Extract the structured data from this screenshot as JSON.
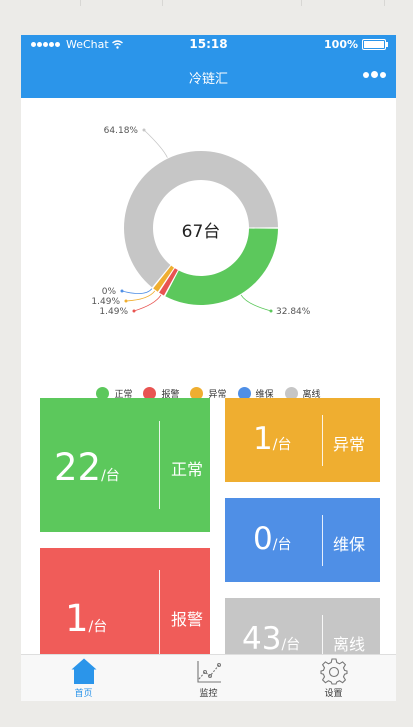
{
  "status_bar": {
    "carrier": "WeChat",
    "time": "15:18",
    "battery": "100%"
  },
  "nav": {
    "title": "冷链汇"
  },
  "chart_data": {
    "type": "pie",
    "variant": "donut",
    "center_label": "67台",
    "total": 67,
    "slices": [
      {
        "name": "正常",
        "value": 22,
        "percent": "32.84%",
        "color": "#5cc85c"
      },
      {
        "name": "报警",
        "value": 1,
        "percent": "1.49%",
        "color": "#e85451"
      },
      {
        "name": "异常",
        "value": 1,
        "percent": "1.49%",
        "color": "#efae30"
      },
      {
        "name": "维保",
        "value": 0,
        "percent": "0%",
        "color": "#4f8fe6"
      },
      {
        "name": "离线",
        "value": 43,
        "percent": "64.18%",
        "color": "#c6c6c6"
      }
    ],
    "legend_placement": "bottom"
  },
  "tiles": {
    "unit": "/台",
    "normal": {
      "value": "22",
      "label": "正常",
      "color": "#5cc85c"
    },
    "alarm": {
      "value": "1",
      "label": "报警",
      "color": "#f05c59"
    },
    "abnormal": {
      "value": "1",
      "label": "异常",
      "color": "#efae30"
    },
    "maintenance": {
      "value": "0",
      "label": "维保",
      "color": "#4f8fe6"
    },
    "offline": {
      "value": "43",
      "label": "离线",
      "color": "#c6c6c6"
    }
  },
  "tabbar": {
    "home": {
      "label": "首页",
      "icon": "home-icon",
      "active": true
    },
    "monitor": {
      "label": "监控",
      "icon": "monitor-chart-icon"
    },
    "settings": {
      "label": "设置",
      "icon": "gear-icon"
    }
  },
  "colors": {
    "primary": "#2b95ea"
  }
}
